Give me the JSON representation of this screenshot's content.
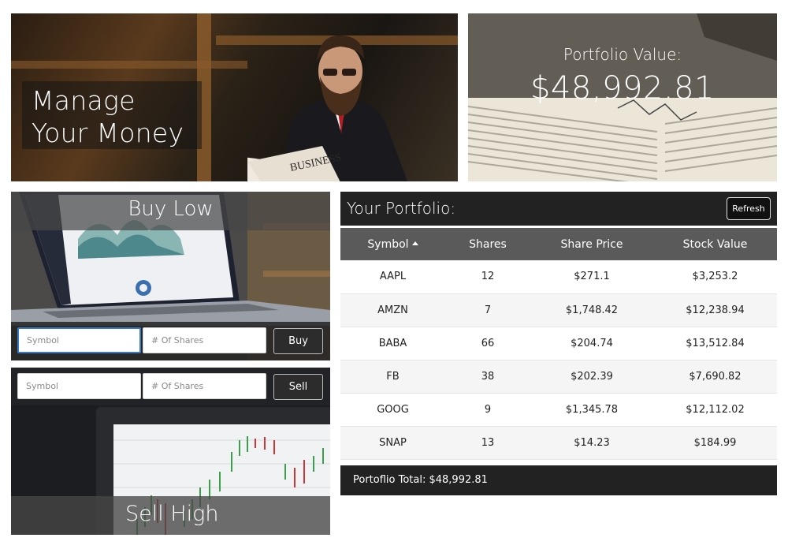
{
  "hero": {
    "title_line1": "Manage",
    "title_line2": "Your Money",
    "newspaper_text": "BUSINESS"
  },
  "portfolio_value": {
    "label": "Portfolio Value:",
    "value": "$48,992.81"
  },
  "buy": {
    "heading": "Buy Low",
    "symbol_placeholder": "Symbol",
    "shares_placeholder": "# Of Shares",
    "button_label": "Buy"
  },
  "sell": {
    "heading": "Sell High",
    "symbol_placeholder": "Symbol",
    "shares_placeholder": "# Of Shares",
    "button_label": "Sell"
  },
  "portfolio": {
    "title": "Your Portfolio:",
    "refresh_label": "Refresh",
    "columns": [
      "Symbol",
      "Shares",
      "Share Price",
      "Stock Value"
    ],
    "sorted_column": "Symbol",
    "sort_direction": "ascending",
    "rows": [
      {
        "symbol": "AAPL",
        "shares": "12",
        "price": "$271.1",
        "value": "$3,253.2"
      },
      {
        "symbol": "AMZN",
        "shares": "7",
        "price": "$1,748.42",
        "value": "$12,238.94"
      },
      {
        "symbol": "BABA",
        "shares": "66",
        "price": "$204.74",
        "value": "$13,512.84"
      },
      {
        "symbol": "FB",
        "shares": "38",
        "price": "$202.39",
        "value": "$7,690.82"
      },
      {
        "symbol": "GOOG",
        "shares": "9",
        "price": "$1,345.78",
        "value": "$12,112.02"
      },
      {
        "symbol": "SNAP",
        "shares": "13",
        "price": "$14.23",
        "value": "$184.99"
      }
    ],
    "total_label": "Portoflio Total: $48,992.81"
  },
  "colors": {
    "dark_bar": "#222222",
    "table_header": "#5a5a5a",
    "focus_border": "#3a78c8"
  }
}
